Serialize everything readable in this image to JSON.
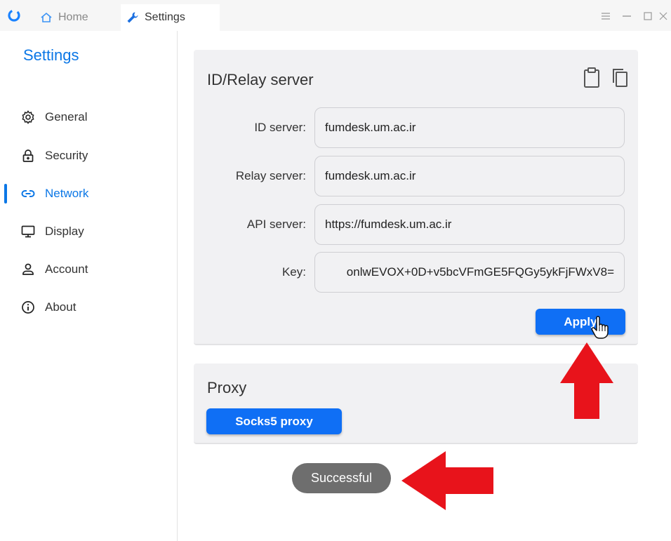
{
  "titlebar": {
    "tabs": [
      {
        "label": "Home",
        "icon": "home-icon"
      },
      {
        "label": "Settings",
        "icon": "wrench-icon"
      }
    ],
    "controls": [
      "menu-icon",
      "minimize-icon",
      "maximize-icon",
      "close-icon"
    ]
  },
  "sidebar": {
    "title": "Settings",
    "items": [
      {
        "label": "General",
        "icon": "gear-icon"
      },
      {
        "label": "Security",
        "icon": "lock-icon"
      },
      {
        "label": "Network",
        "icon": "link-icon",
        "active": true
      },
      {
        "label": "Display",
        "icon": "monitor-icon"
      },
      {
        "label": "Account",
        "icon": "person-icon"
      },
      {
        "label": "About",
        "icon": "info-icon"
      }
    ]
  },
  "relay_card": {
    "title": "ID/Relay server",
    "tools": [
      "clipboard-icon",
      "copy-icon"
    ],
    "fields": [
      {
        "label": "ID server:",
        "value": "fumdesk.um.ac.ir"
      },
      {
        "label": "Relay server:",
        "value": "fumdesk.um.ac.ir"
      },
      {
        "label": "API server:",
        "value": "https://fumdesk.um.ac.ir"
      },
      {
        "label": "Key:",
        "value": "onlwEVOX+0D+v5bcVFmGE5FQGy5ykFjFWxV8="
      }
    ],
    "apply_label": "Apply"
  },
  "proxy_card": {
    "title": "Proxy",
    "socks_label": "Socks5 proxy"
  },
  "toast": {
    "text": "Successful"
  },
  "colors": {
    "accent": "#0b77e6",
    "button": "#0f6ff5",
    "card_bg": "#f1f1f3",
    "toast_bg": "#6e6e6e",
    "annotation_arrow": "#e8131b"
  }
}
